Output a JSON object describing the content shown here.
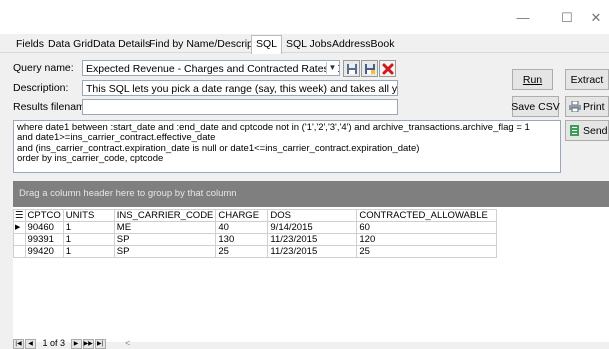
{
  "window": {
    "minimize": "—",
    "maximize": "☐",
    "close": "✕"
  },
  "tabs": [
    {
      "label": "Fields"
    },
    {
      "label": "Data Grid"
    },
    {
      "label": "Data Details"
    },
    {
      "label": "Find by Name/Description"
    },
    {
      "label": "SQL"
    },
    {
      "label": "SQL Jobs"
    },
    {
      "label": "AddressBook"
    }
  ],
  "form": {
    "query_name_label": "Query name:",
    "query_name_value": "Expected Revenue - Charges and Contracted Rates (Drill Down",
    "description_label": "Description:",
    "description_value": "This SQL lets you pick a date range (say, this week) and takes all your CPT codes f",
    "results_filename_label": "Results filename:",
    "results_filename_value": ""
  },
  "buttons": {
    "run": "Run",
    "extract": "Extract",
    "save_csv": "Save CSV",
    "print": "Print",
    "send": "Send"
  },
  "sql_lines": [
    "where date1 between :start_date and :end_date and cptcode not in ('1','2','3','4') and archive_transactions.archive_flag = 1",
    "and date1>=ins_carrier_contract.effective_date",
    "and (ins_carrier_contract.expiration_date is null or date1<=ins_carrier_contract.expiration_date)",
    "order by ins_carrier_code, cptcode"
  ],
  "group_panel_text": "Drag a column header here to group by that column",
  "grid": {
    "columns": [
      "CPTCO",
      "UNITS",
      "INS_CARRIER_CODE",
      "CHARGE",
      "DOS",
      "CONTRACTED_ALLOWABLE"
    ],
    "rows": [
      [
        "90460",
        "1",
        "ME",
        "40",
        "9/14/2015",
        "60"
      ],
      [
        "99391",
        "1",
        "SP",
        "130",
        "11/23/2015",
        "120"
      ],
      [
        "99420",
        "1",
        "SP",
        "25",
        "11/23/2015",
        "25"
      ]
    ]
  },
  "pager": {
    "text": "1 of 3",
    "scroll_left": "<"
  }
}
